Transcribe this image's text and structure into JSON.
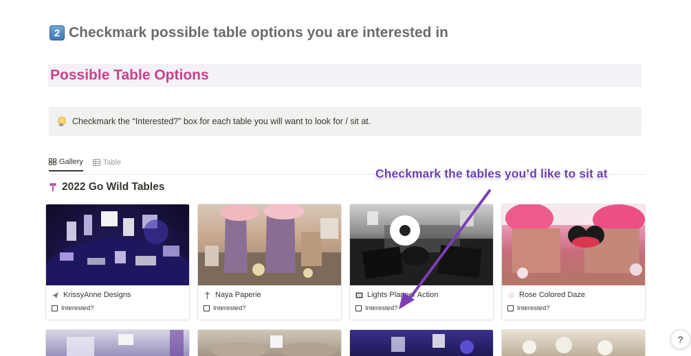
{
  "step": {
    "keycap": "2",
    "title": "Checkmark possible table options you are interested in"
  },
  "section": {
    "title": "Possible Table Options"
  },
  "callout": {
    "icon": "lightbulb-icon",
    "text": "Checkmark the “Interested?” box for each table you will want to look for / sit at."
  },
  "views": {
    "tabs": [
      {
        "label": "Gallery",
        "icon": "gallery-icon",
        "active": true
      },
      {
        "label": "Table",
        "icon": "table-icon",
        "active": false
      }
    ]
  },
  "database": {
    "title": "2022 Go Wild Tables",
    "icon": "pin-icon"
  },
  "annotation": {
    "text": "Checkmark the tables you’d like to sit at",
    "color": "#6b3fb0"
  },
  "cards": [
    {
      "name": "KrissyAnne Designs",
      "property_label": "Interested?",
      "checked": false
    },
    {
      "name": "Naya Paperie",
      "property_label": "Interested?",
      "checked": false
    },
    {
      "name": "Lights Planner Action",
      "property_label": "Interested?",
      "checked": false
    },
    {
      "name": "Rose Colored Daze",
      "property_label": "Interested?",
      "checked": false
    }
  ],
  "help": {
    "label": "?"
  },
  "colors": {
    "section_title": "#c9418e",
    "section_bg": "#f4f1f8",
    "callout_bg": "#f1f1ef",
    "arrow": "#7b3fb5"
  }
}
